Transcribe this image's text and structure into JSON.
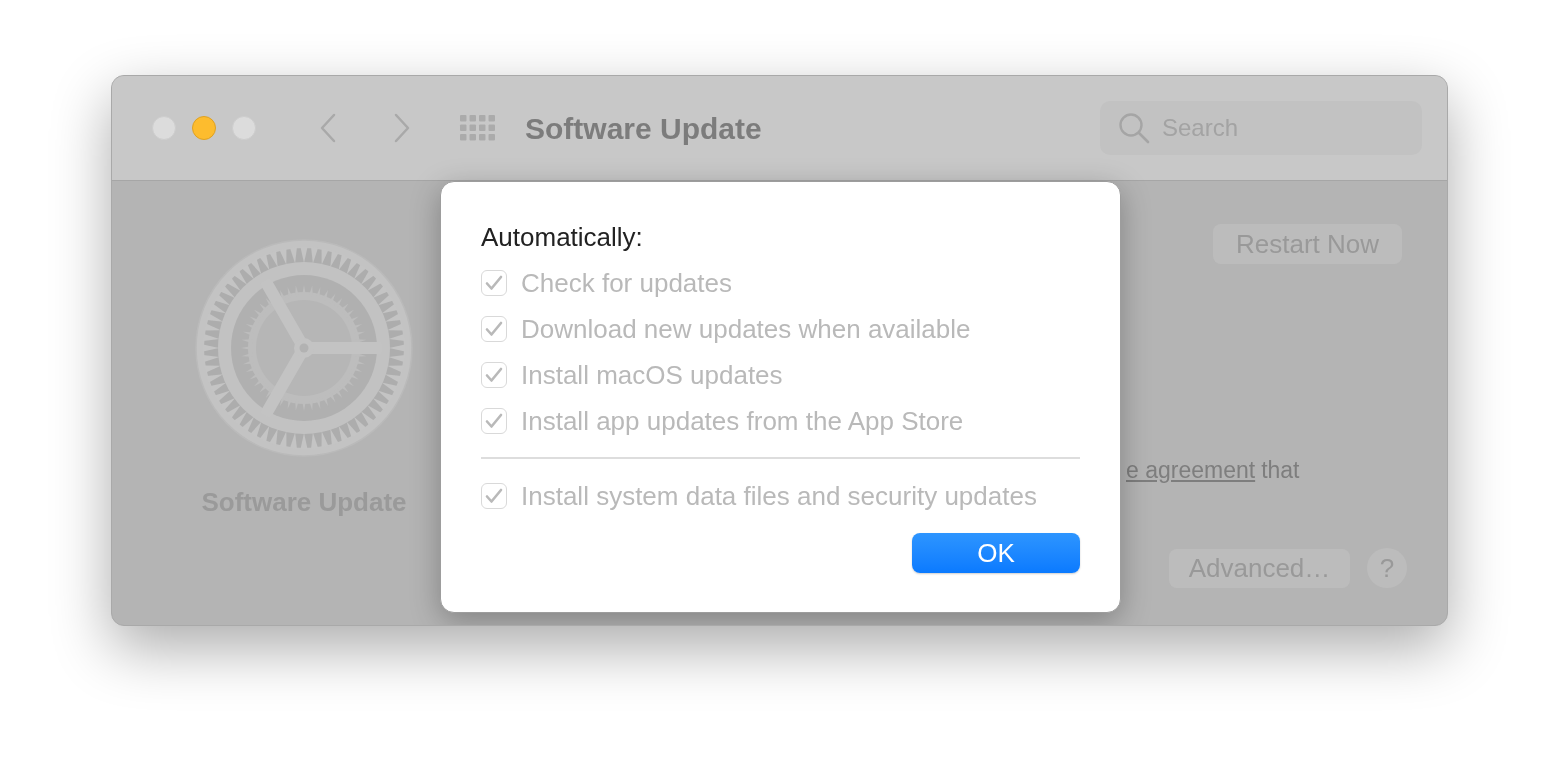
{
  "window": {
    "controls": [
      {
        "kind": "close",
        "disabled": true
      },
      {
        "kind": "minimize",
        "disabled": false
      },
      {
        "kind": "zoom",
        "disabled": true
      }
    ],
    "title": "Software Update",
    "search": {
      "placeholder": "Search"
    }
  },
  "pane": {
    "icon_label": "Software Update",
    "restart_button": "Restart Now",
    "notice": {
      "link": "e agreement",
      "rest": "that"
    },
    "advanced_button": "Advanced…",
    "help_button": "?"
  },
  "sheet": {
    "heading": "Automatically:",
    "options": [
      {
        "label": "Check for updates",
        "checked": true,
        "disabled": true
      },
      {
        "label": "Download new updates when available",
        "checked": true,
        "disabled": true
      },
      {
        "label": "Install macOS updates",
        "checked": true,
        "disabled": true
      },
      {
        "label": "Install app updates from the App Store",
        "checked": true,
        "disabled": true
      }
    ],
    "extra_options": [
      {
        "label": "Install system data files and security updates",
        "checked": true,
        "disabled": true
      }
    ],
    "ok_button": "OK"
  }
}
